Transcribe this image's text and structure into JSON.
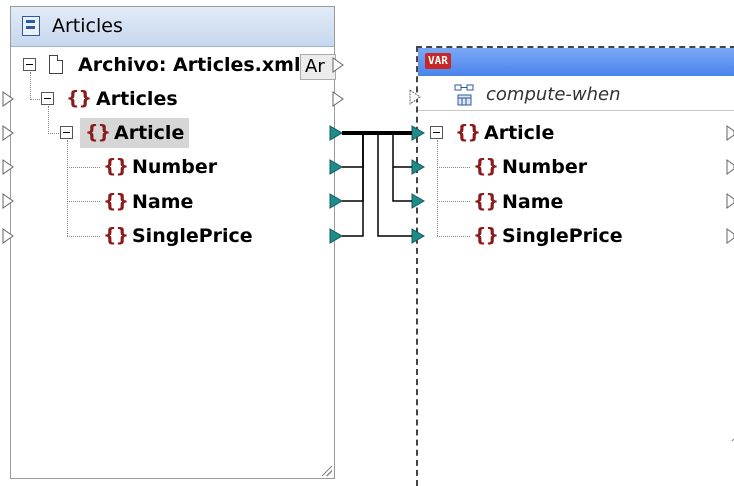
{
  "left_component": {
    "title": "Articles",
    "file_label": "Archivo: Articles.xml",
    "file_button": "Ar",
    "items": [
      {
        "label": "Articles"
      },
      {
        "label": "Article"
      },
      {
        "label": "Number"
      },
      {
        "label": "Name"
      },
      {
        "label": "SinglePrice"
      }
    ]
  },
  "right_component": {
    "badge": "VAR",
    "compute_when": "compute-when",
    "items": [
      {
        "label": "Article"
      },
      {
        "label": "Number"
      },
      {
        "label": "Name"
      },
      {
        "label": "SinglePrice"
      }
    ]
  },
  "icons": {
    "element": "{}",
    "connector_color": "#1f8b8b",
    "accent_titlebar": "#4a84ec",
    "element_brace_color": "#8b1a1a"
  }
}
